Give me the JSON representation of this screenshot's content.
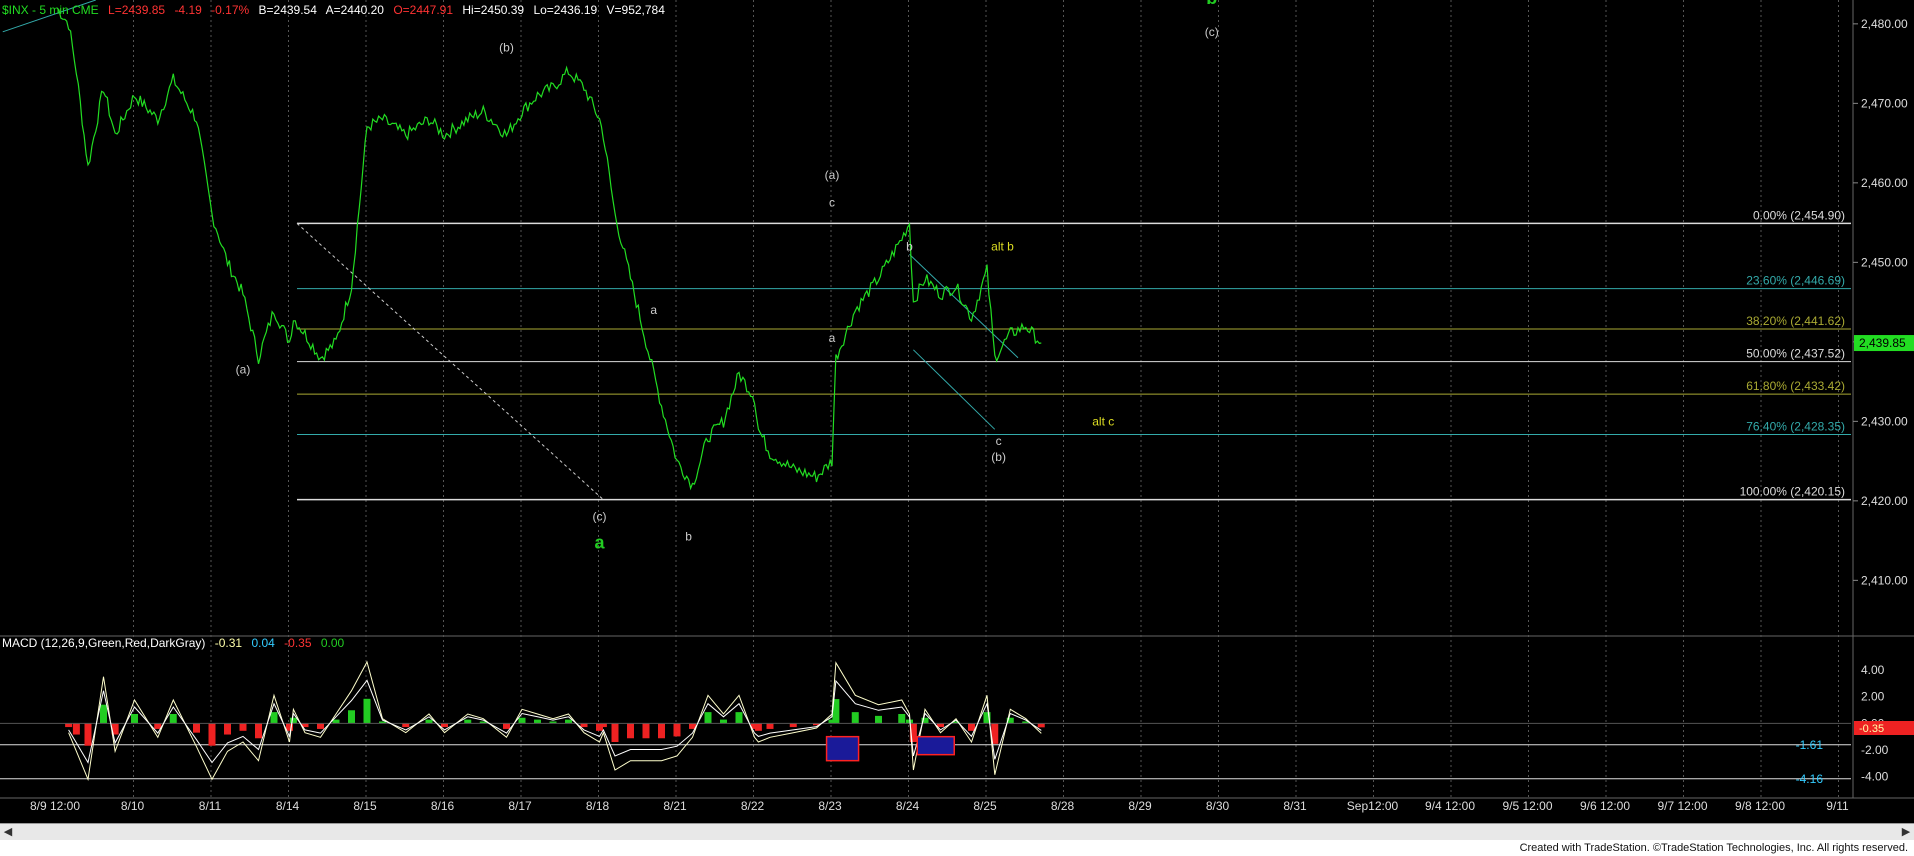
{
  "header": {
    "symbol": "$INX - 5 min  CME",
    "last": "L=2439.85",
    "change": "-4.19",
    "pct": "-0.17%",
    "bid": "B=2439.54",
    "ask": "A=2440.20",
    "open": "O=2447.91",
    "high": "Hi=2450.39",
    "low": "Lo=2436.19",
    "volume": "V=952,784"
  },
  "macd": {
    "label": "MACD (12,26,9,Green,Red,DarkGray)",
    "v1": "-0.31",
    "v2": "0.04",
    "v3": "-0.35",
    "v4": "0.00",
    "level_1": "-1.61",
    "level_2": "-4.16",
    "axis_ticks": [
      "4.00",
      "2.00",
      "0.00",
      "-2.00",
      "-4.00"
    ],
    "last_marker": "-0.35"
  },
  "footer": {
    "credit": "Created with TradeStation. ©TradeStation Technologies, Inc. All rights reserved."
  },
  "colors": {
    "price": "#22dd22",
    "fib_white": "#dcdcdc",
    "fib_teal": "#33aaaa",
    "fib_olive": "#aaaa33",
    "label_green": "#22cc22",
    "label_yellow": "#dddd22",
    "label_gray": "#cccccc",
    "macd_line1": "#ffffcc",
    "macd_line2": "#ffffff",
    "hist_pos": "#22cc22",
    "hist_neg": "#ee2222"
  },
  "chart_data": {
    "type": "line",
    "title": "$INX - 5 min  CME",
    "x_ticks": [
      "8/9 12:00",
      "8/10",
      "8/11",
      "8/14",
      "8/15",
      "8/16",
      "8/17",
      "8/18",
      "8/21",
      "8/22",
      "8/23",
      "8/24",
      "8/25",
      "8/28",
      "8/29",
      "8/30",
      "8/31",
      "Sep12:00",
      "9/4 12:00",
      "9/5 12:00",
      "9/6 12:00",
      "9/7 12:00",
      "9/8 12:00",
      "9/11"
    ],
    "y_ticks": [
      "2,480.00",
      "2,470.00",
      "2,460.00",
      "2,450.00",
      "2,440.00",
      "2,430.00",
      "2,420.00",
      "2,410.00"
    ],
    "ylim": [
      2403,
      2483
    ],
    "last_price_label": "2,439.85",
    "series": [
      {
        "x": [
          0,
          0.15,
          0.25,
          0.4,
          0.6,
          0.75,
          1.0,
          1.3,
          1.5,
          1.8,
          2.0,
          2.2,
          2.4,
          2.6,
          2.8,
          3.0,
          3.05,
          3.2,
          3.4,
          3.6,
          3.8,
          4.0,
          4.2,
          4.5,
          4.8,
          5.0,
          5.3,
          5.5,
          5.8,
          6.0,
          6.2,
          6.4,
          6.6,
          6.8,
          7.0,
          7.05,
          7.2,
          7.4,
          7.6,
          7.8,
          8.0,
          8.2,
          8.4,
          8.6,
          8.8,
          9.0,
          9.05,
          9.2,
          9.5,
          9.8,
          10.0,
          10.05,
          10.3,
          10.6,
          10.9,
          11.0,
          11.05,
          11.2,
          11.4,
          11.6,
          11.8,
          12.0,
          12.1,
          12.3,
          12.5,
          12.7
        ],
        "values": [
          2482,
          2480,
          2474,
          2462,
          2472,
          2466,
          2471,
          2468,
          2473,
          2468,
          2456,
          2450,
          2446,
          2438,
          2444,
          2440,
          2443,
          2441,
          2438,
          2440,
          2447,
          2467,
          2468,
          2466,
          2468,
          2466,
          2468,
          2469,
          2466,
          2469,
          2471,
          2472,
          2474,
          2472,
          2468,
          2466,
          2456,
          2448,
          2440,
          2432,
          2425,
          2422,
          2428,
          2430,
          2436,
          2433,
          2429,
          2426,
          2424,
          2423,
          2425,
          2438,
          2444,
          2448,
          2453,
          2455,
          2445,
          2448,
          2446,
          2447,
          2443,
          2449,
          2438,
          2441,
          2442,
          2439.85
        ]
      }
    ],
    "fib_levels": [
      {
        "label": "0.00% (2,454.90)",
        "value": 2454.9
      },
      {
        "label": "23.60% (2,446.69)",
        "value": 2446.69
      },
      {
        "label": "38.20% (2,441.62)",
        "value": 2441.62
      },
      {
        "label": "50.00% (2,437.52)",
        "value": 2437.52
      },
      {
        "label": "61.80% (2,433.42)",
        "value": 2433.42
      },
      {
        "label": "76.40% (2,428.35)",
        "value": 2428.35
      },
      {
        "label": "100.00% (2,420.15)",
        "value": 2420.15
      }
    ],
    "annotations": [
      {
        "text": "b",
        "x": 14.9,
        "y": 2482.5,
        "color": "label_green",
        "bold": true,
        "size": 18
      },
      {
        "text": "(c)",
        "x": 14.9,
        "y": 2478.5,
        "color": "label_gray"
      },
      {
        "text": "(b)",
        "x": 5.8,
        "y": 2476.5,
        "color": "label_gray"
      },
      {
        "text": "(a)",
        "x": 2.4,
        "y": 2436.0,
        "color": "label_gray"
      },
      {
        "text": "(a)",
        "x": 10.0,
        "y": 2460.5,
        "color": "label_gray"
      },
      {
        "text": "c",
        "x": 10.0,
        "y": 2457.0,
        "color": "label_gray"
      },
      {
        "text": "a",
        "x": 10.0,
        "y": 2440.0,
        "color": "label_gray"
      },
      {
        "text": "b",
        "x": 11.0,
        "y": 2451.5,
        "color": "label_gray"
      },
      {
        "text": "alt b",
        "x": 12.2,
        "y": 2451.5,
        "color": "label_yellow"
      },
      {
        "text": "a",
        "x": 7.7,
        "y": 2443.5,
        "color": "label_gray"
      },
      {
        "text": "(c)",
        "x": 7.0,
        "y": 2417.5,
        "color": "label_gray"
      },
      {
        "text": "a",
        "x": 7.0,
        "y": 2414.0,
        "color": "label_green",
        "bold": true,
        "size": 18
      },
      {
        "text": "b",
        "x": 8.15,
        "y": 2415.0,
        "color": "label_gray"
      },
      {
        "text": "c",
        "x": 12.15,
        "y": 2427.0,
        "color": "label_gray"
      },
      {
        "text": "(b)",
        "x": 12.15,
        "y": 2425.0,
        "color": "label_gray"
      },
      {
        "text": "alt c",
        "x": 13.5,
        "y": 2429.5,
        "color": "label_yellow"
      }
    ]
  }
}
